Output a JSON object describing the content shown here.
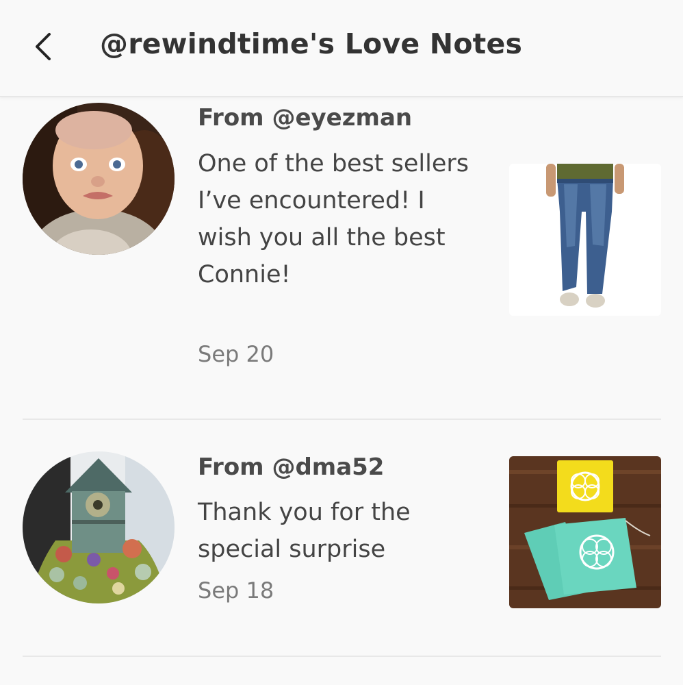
{
  "header": {
    "title": "@rewindtime's Love Notes",
    "back_icon": "chevron-left-icon"
  },
  "notes": [
    {
      "from": "From @eyezman",
      "message": "One of the best sellers I’ve encountered! I wish you all the best Connie!",
      "date": "Sep 20"
    },
    {
      "from": "From @dma52",
      "message": "Thank you for the special surprise",
      "date": "Sep 18"
    }
  ]
}
